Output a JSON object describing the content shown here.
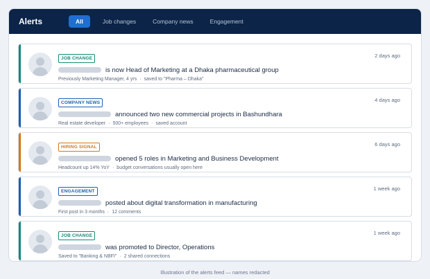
{
  "header": {
    "title": "Alerts",
    "tabs": [
      {
        "label": "All",
        "active": true
      },
      {
        "label": "Job changes",
        "active": false
      },
      {
        "label": "Company news",
        "active": false
      },
      {
        "label": "Engagement",
        "active": false
      }
    ]
  },
  "alerts": [
    {
      "badge": "JOB CHANGE",
      "badge_color": "#12897a",
      "accent_color": "#12897a",
      "action": "is now Head of Marketing at a Dhaka pharmaceutical group",
      "meta": [
        "Previously Marketing Manager, 4 yrs",
        "saved to \"Pharma – Dhaka\""
      ],
      "time": "2 days ago",
      "redacted": true
    },
    {
      "badge": "COMPANY NEWS",
      "badge_color": "#1a5fb4",
      "accent_color": "#1a5fb4",
      "action": "announced two new commercial projects in Bashundhara",
      "meta": [
        "Real estate developer",
        "500+ employees",
        "saved account"
      ],
      "time": "4 days ago",
      "redacted": true
    },
    {
      "badge": "HIRING SIGNAL",
      "badge_color": "#d4771a",
      "accent_color": "#d4771a",
      "action": "opened 5 roles in Marketing and Business Development",
      "meta": [
        "Headcount up 14% YoY",
        "budget conversations usually open here"
      ],
      "time": "6 days ago",
      "redacted": true
    },
    {
      "badge": "ENGAGEMENT",
      "badge_color": "#1a5fb4",
      "accent_color": "#1a5fb4",
      "action": "posted about digital transformation in manufacturing",
      "meta": [
        "First post in 3 months",
        "12 comments"
      ],
      "time": "1 week ago",
      "redacted": true
    },
    {
      "badge": "JOB CHANGE",
      "badge_color": "#12897a",
      "accent_color": "#12897a",
      "action": "was promoted to Director, Operations",
      "meta": [
        "Saved to \"Banking & NBFI\"",
        "2 shared connections"
      ],
      "time": "1 week ago",
      "redacted": true
    }
  ],
  "footer": {
    "caption": "Illustration of the alerts feed — names redacted"
  }
}
